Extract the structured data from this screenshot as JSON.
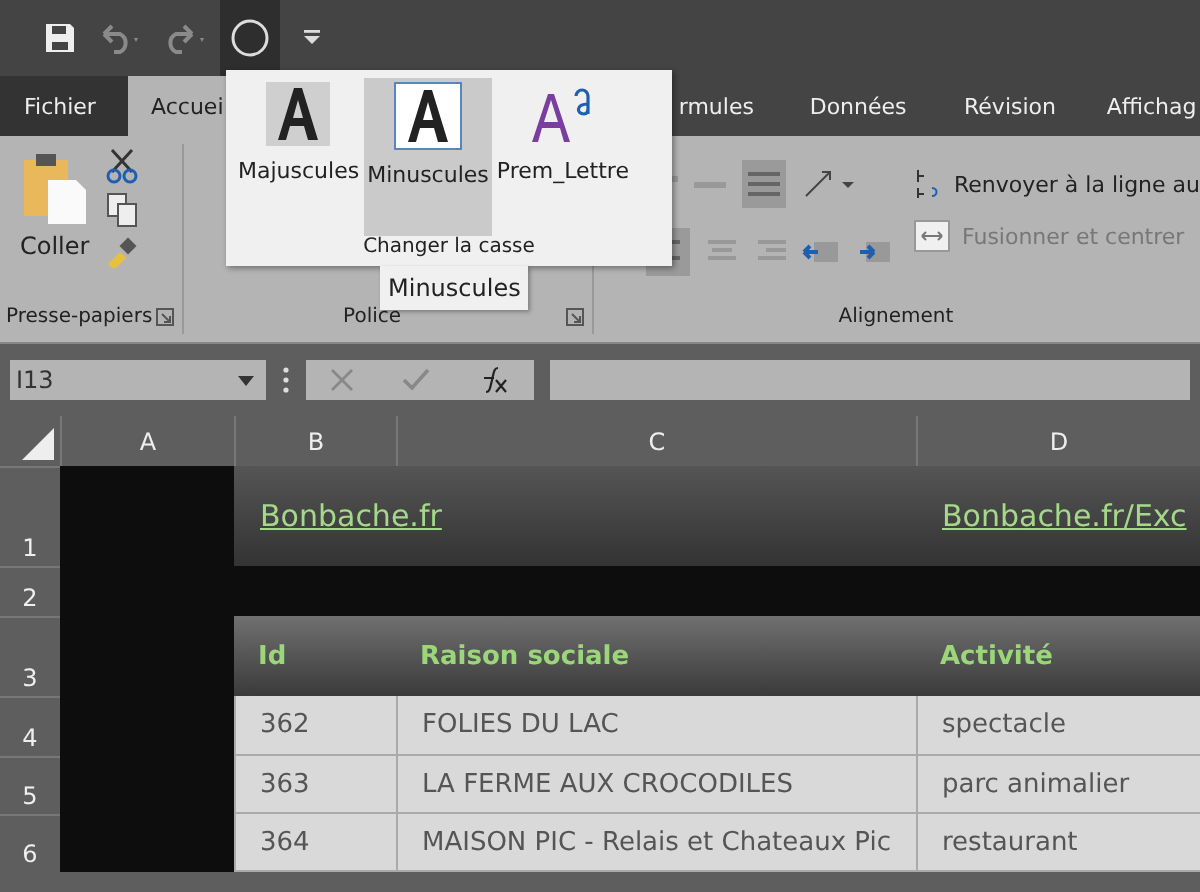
{
  "quick_access": [
    {
      "kind": "save",
      "selected": false
    },
    {
      "kind": "undo",
      "selected": false
    },
    {
      "kind": "redo",
      "selected": false
    },
    {
      "kind": "circle",
      "selected": true
    },
    {
      "kind": "customize",
      "selected": false
    }
  ],
  "tabs": [
    {
      "label": "Fichier",
      "kind": "file",
      "selected": false
    },
    {
      "label": "Accuei",
      "kind": "tab",
      "selected": true
    },
    {
      "label": "rmules",
      "kind": "tab",
      "selected": false
    },
    {
      "label": "Données",
      "kind": "tab",
      "selected": false
    },
    {
      "label": "Révision",
      "kind": "tab",
      "selected": false
    },
    {
      "label": "Affichag",
      "kind": "tab",
      "selected": false
    }
  ],
  "ribbon": {
    "clipboard": {
      "paste": "Coller",
      "label": "Presse-papiers"
    },
    "font": {
      "label": "Police"
    },
    "alignment": {
      "wrap": "Renvoyer à la ligne au",
      "merge": "Fusionner et centrer",
      "merge_disabled": true,
      "label": "Alignement"
    }
  },
  "case_popup": {
    "items": [
      {
        "label": "Majuscules",
        "kind": "upper",
        "selected": false
      },
      {
        "label": "Minuscules",
        "kind": "lower",
        "selected": true
      },
      {
        "label": "Prem_Lettre",
        "kind": "proper",
        "selected": false
      }
    ],
    "group_label": "Changer la casse",
    "tooltip": "Minuscules"
  },
  "formula_bar": {
    "name_box": "I13"
  },
  "sheet": {
    "columns": [
      "A",
      "B",
      "C",
      "D"
    ],
    "row_numbers": [
      "1",
      "2",
      "3",
      "4",
      "5",
      "6"
    ],
    "links": [
      "Bonbache.fr",
      "Bonbache.fr/Exc"
    ],
    "table": {
      "headers": [
        "Id",
        "Raison sociale",
        "Activité"
      ],
      "rows": [
        [
          "362",
          "FOLIES DU LAC",
          "spectacle"
        ],
        [
          "363",
          "LA FERME AUX CROCODILES",
          "parc animalier"
        ],
        [
          "364",
          "MAISON PIC - Relais et Chateaux Pic",
          "restaurant"
        ]
      ]
    }
  }
}
